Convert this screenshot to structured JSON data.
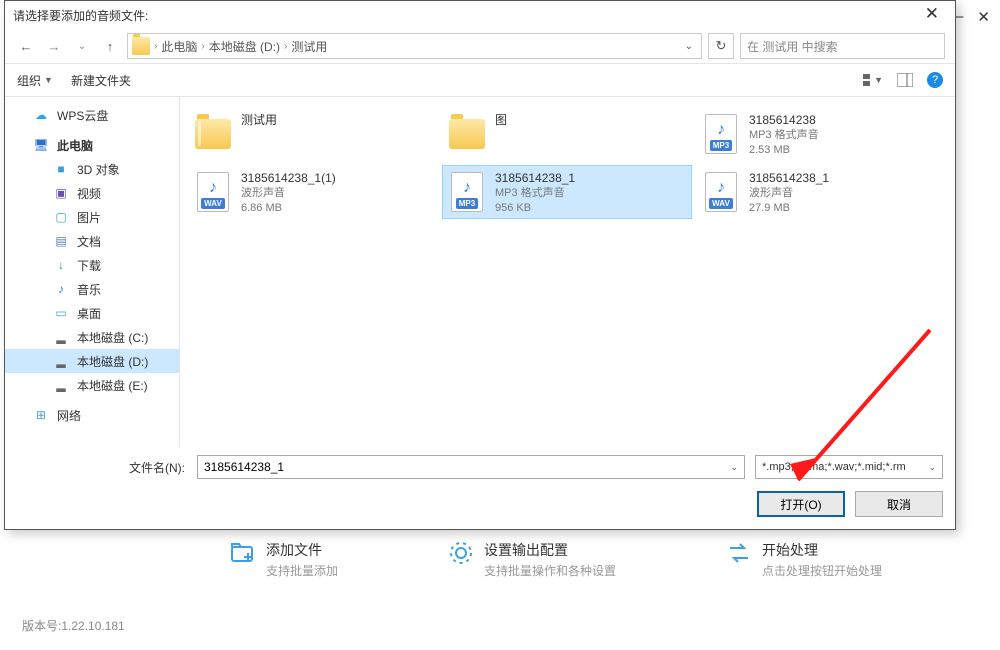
{
  "bg": {
    "add": {
      "title": "添加文件",
      "sub": "支持批量添加"
    },
    "conf": {
      "title": "设置输出配置",
      "sub": "支持批量操作和各种设置"
    },
    "start": {
      "title": "开始处理",
      "sub": "点击处理按钮开始处理"
    },
    "version": "版本号:1.22.10.181"
  },
  "dialog": {
    "title": "请选择要添加的音频文件:",
    "path": {
      "node1": "此电脑",
      "node2": "本地磁盘 (D:)",
      "node3": "测试用"
    },
    "search_placeholder": "在 测试用 中搜索",
    "toolbar": {
      "org": "组织",
      "newf": "新建文件夹"
    },
    "side": [
      {
        "label": "WPS云盘",
        "ico": "cloud",
        "color": "#2aa3ef"
      },
      {
        "label": "此电脑",
        "ico": "pc",
        "color": "#2a6fd6",
        "bold": true
      },
      {
        "label": "3D 对象",
        "ico": "cube",
        "color": "#39a0d7",
        "sub": true
      },
      {
        "label": "视频",
        "ico": "video",
        "color": "#6b4fae",
        "sub": true
      },
      {
        "label": "图片",
        "ico": "image",
        "color": "#3aa6d0",
        "sub": true
      },
      {
        "label": "文档",
        "ico": "doc",
        "color": "#5a7fae",
        "sub": true
      },
      {
        "label": "下载",
        "ico": "down",
        "color": "#2e9a4a",
        "sub": true
      },
      {
        "label": "音乐",
        "ico": "music",
        "color": "#1e88e5",
        "sub": true
      },
      {
        "label": "桌面",
        "ico": "desk",
        "color": "#4aa3d0",
        "sub": true
      },
      {
        "label": "本地磁盘 (C:)",
        "ico": "drive",
        "sub": true
      },
      {
        "label": "本地磁盘 (D:)",
        "ico": "drive",
        "sub": true,
        "sel": true
      },
      {
        "label": "本地磁盘 (E:)",
        "ico": "drive",
        "sub": true
      },
      {
        "label": "网络",
        "ico": "net",
        "color": "#4aa3d0"
      }
    ],
    "files": [
      {
        "name": "测试用",
        "type": "folder-open"
      },
      {
        "name": "图",
        "type": "folder"
      },
      {
        "name": "3185614238",
        "sub1": "MP3 格式声音",
        "sub2": "2.53 MB",
        "tag": "MP3"
      },
      {
        "name": "3185614238_1(1)",
        "sub1": "波形声音",
        "sub2": "6.86 MB",
        "tag": "WAV"
      },
      {
        "name": "3185614238_1",
        "sub1": "MP3 格式声音",
        "sub2": "956 KB",
        "tag": "MP3",
        "sel": true
      },
      {
        "name": "3185614238_1",
        "sub1": "波形声音",
        "sub2": "27.9 MB",
        "tag": "WAV"
      }
    ],
    "fn_label": "文件名(N):",
    "fn_value": "3185614238_1",
    "filter": "*.mp3;*.wma;*.wav;*.mid;*.rm",
    "open": "打开(O)",
    "cancel": "取消"
  }
}
